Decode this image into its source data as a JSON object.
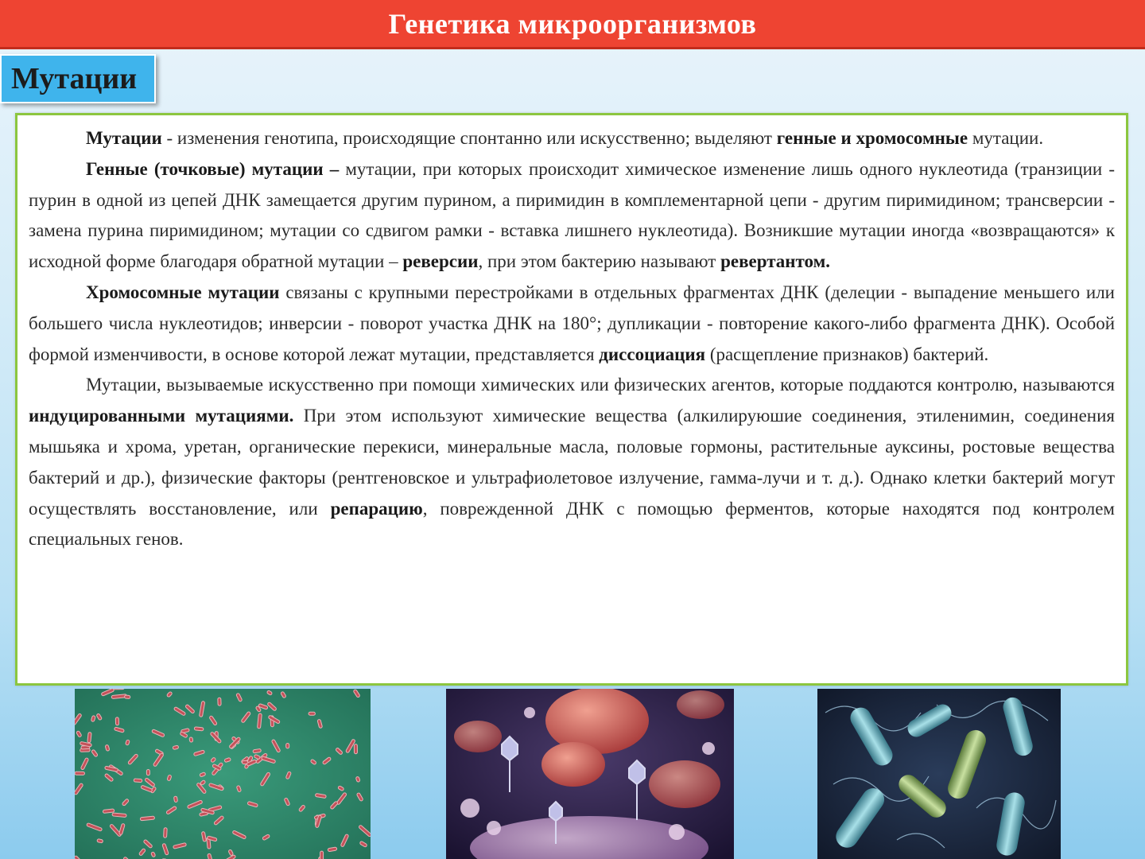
{
  "header": {
    "title": "Генетика микроорганизмов"
  },
  "section": {
    "label": "Мутации"
  },
  "paragraphs": [
    {
      "parts": [
        {
          "b": true,
          "t": "Мутации"
        },
        {
          "b": false,
          "t": " - изменения генотипа, происходящие спонтанно или искусственно; выделяют "
        },
        {
          "b": true,
          "t": "генные и хромосомные"
        },
        {
          "b": false,
          "t": " мутации."
        }
      ]
    },
    {
      "parts": [
        {
          "b": true,
          "t": "Генные (точковые) мутации –"
        },
        {
          "b": false,
          "t": " мутации, при которых происходит химическое изменение лишь одного нуклеотида (транзиции - пурин в одной из цепей ДНК замещается другим пурином, а пиримидин в комплементарной цепи - другим пиримидином; трансверсии -  замена пурина пиримидином; мутации со сдвигом рамки - вставка лишнего нуклеотида). Возникшие мутации иногда «возвращаются» к исходной форме благодаря обратной мутации – "
        },
        {
          "b": true,
          "t": "реверсии"
        },
        {
          "b": false,
          "t": ", при этом  бактерию называют "
        },
        {
          "b": true,
          "t": "ревертантом."
        }
      ]
    },
    {
      "parts": [
        {
          "b": true,
          "t": "Хромосомные мутации"
        },
        {
          "b": false,
          "t": " связаны с крупными перестройками в отдельных фрагментах ДНК (делеции - выпадение меньшего или большего числа нуклеотидов; инверсии - поворот участка ДНК на 180°; дупликации - повторение какого-либо фрагмента ДНК). Особой формой изменчивости, в основе которой лежат мутации, представляется "
        },
        {
          "b": true,
          "t": "диссоциация"
        },
        {
          "b": false,
          "t": " (расщепление признаков) бактерий."
        }
      ]
    },
    {
      "parts": [
        {
          "b": false,
          "t": "Мутации, вызываемые искусственно при помощи химических или физических агентов, которые поддаются контролю, называются "
        },
        {
          "b": true,
          "t": "индуцированными мутациями."
        },
        {
          "b": false,
          "t": " При этом используют химические вещества (алкилируюшие соединения, этиленимин, соединения мышьяка и хрома, уретан, органические перекиси, минеральные масла, половые гормоны, растительные ауксины, ростовые вещества бактерий и др.), физические факторы (рентгеновское и ультрафиолетовое излучение, гамма-лучи и т. д.). Однако клетки бактерий могут осуществлять восстановление, или "
        },
        {
          "b": true,
          "t": "репарацию"
        },
        {
          "b": false,
          "t": ", поврежденной ДНК с помощью ферментов, которые находятся под контролем специальных генов."
        }
      ]
    }
  ],
  "images": [
    {
      "subject": "bacteria-on-green-micrograph",
      "bg": "#2f8a6c",
      "accent": "#c4525a"
    },
    {
      "subject": "bacteriophages-attacking-bacteria",
      "bg": "#2a1d3f",
      "accent": "#d8706a"
    },
    {
      "subject": "rod-bacteria-with-flagella",
      "bg": "#1a2740",
      "accent": "#7fc6d8"
    }
  ]
}
